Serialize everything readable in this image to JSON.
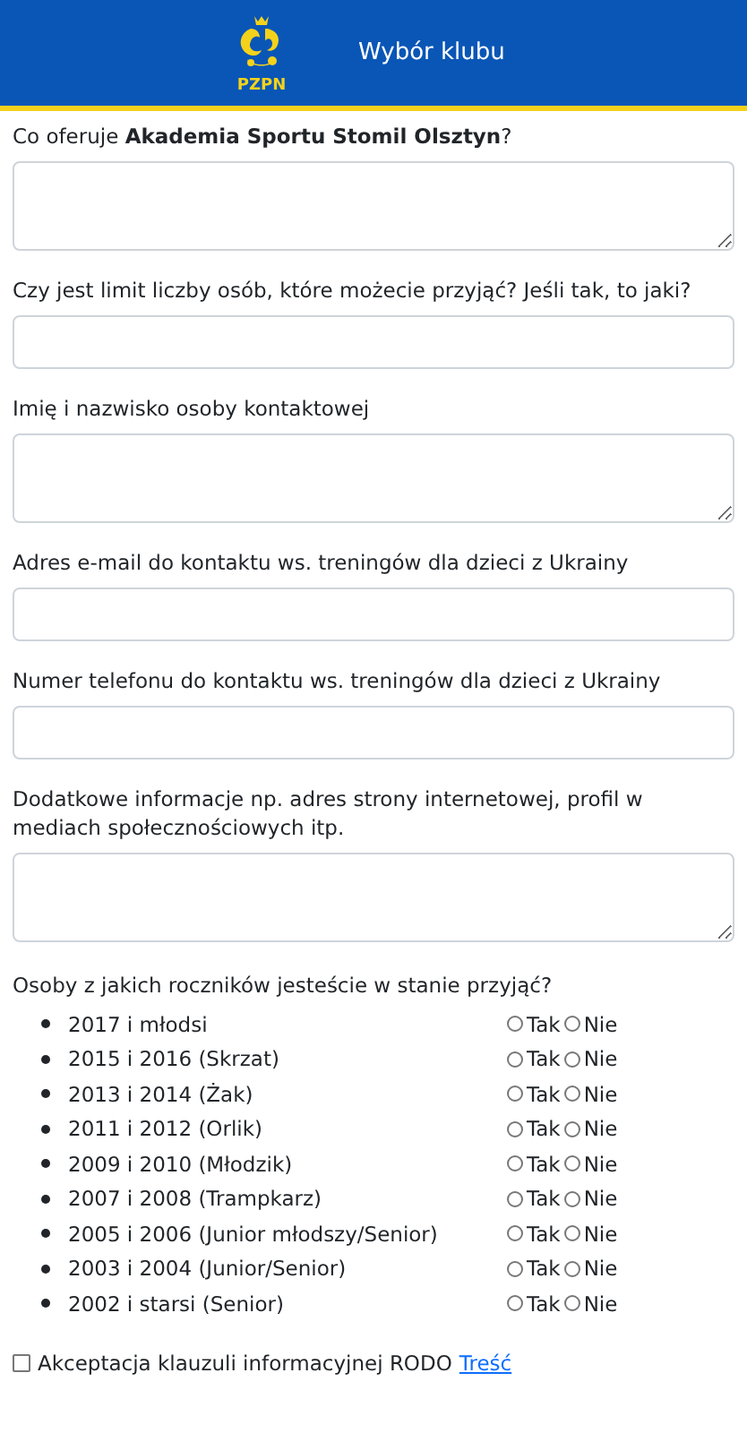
{
  "header": {
    "logo_text": "PZPN",
    "title": "Wybór klubu"
  },
  "fields": [
    {
      "kind": "textarea",
      "label": "Co oferuje **Akademia Sportu Stomil Olsztyn**?"
    },
    {
      "kind": "input",
      "label": "Czy jest limit liczby osób, które możecie przyjąć? Jeśli tak, to jaki?"
    },
    {
      "kind": "textarea",
      "label": "Imię i nazwisko osoby kontaktowej"
    },
    {
      "kind": "input",
      "label": "Adres e-mail do kontaktu ws. treningów dla dzieci z Ukrainy"
    },
    {
      "kind": "input",
      "label": "Numer telefonu do kontaktu ws. treningów dla dzieci z Ukrainy"
    },
    {
      "kind": "textarea",
      "label": "Dodatkowe informacje np. adres strony internetowej, profil w mediach społecznościowych itp."
    }
  ],
  "age_groups": {
    "question": "Osoby z jakich roczników jesteście w stanie przyjąć?",
    "rows": [
      {
        "label": "2017 i młodsi",
        "options": [
          {
            "label": "Tak",
            "selected": false
          },
          {
            "label": "Nie",
            "selected": false
          }
        ]
      },
      {
        "label": "2015 i 2016 (Skrzat)",
        "options": [
          {
            "label": "Tak",
            "selected": false
          },
          {
            "label": "Nie",
            "selected": false
          }
        ]
      },
      {
        "label": "2013 i 2014 (Żak)",
        "options": [
          {
            "label": "Tak",
            "selected": false
          },
          {
            "label": "Nie",
            "selected": false
          }
        ]
      },
      {
        "label": "2011 i 2012 (Orlik)",
        "options": [
          {
            "label": "Tak",
            "selected": false
          },
          {
            "label": "Nie",
            "selected": false
          }
        ]
      },
      {
        "label": "2009 i 2010 (Młodzik)",
        "options": [
          {
            "label": "Tak",
            "selected": false
          },
          {
            "label": "Nie",
            "selected": false
          }
        ]
      },
      {
        "label": "2007 i 2008 (Trampkarz)",
        "options": [
          {
            "label": "Tak",
            "selected": false
          },
          {
            "label": "Nie",
            "selected": false
          }
        ]
      },
      {
        "label": "2005 i 2006 (Junior młodszy/Senior)",
        "options": [
          {
            "label": "Tak",
            "selected": false
          },
          {
            "label": "Nie",
            "selected": false
          }
        ]
      },
      {
        "label": "2003 i 2004 (Junior/Senior)",
        "options": [
          {
            "label": "Tak",
            "selected": false
          },
          {
            "label": "Nie",
            "selected": false
          }
        ]
      },
      {
        "label": "2002 i starsi (Senior)",
        "options": [
          {
            "label": "Tak",
            "selected": false
          },
          {
            "label": "Nie",
            "selected": false
          }
        ]
      }
    ]
  },
  "consent": {
    "checked": false,
    "label": "Akceptacja klauzuli informacyjnej RODO",
    "link": "Treść"
  }
}
